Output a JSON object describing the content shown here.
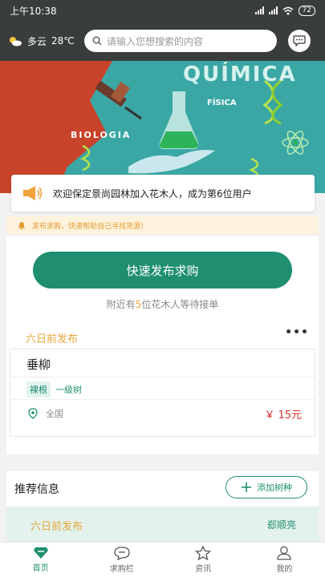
{
  "status_bar": {
    "time": "上午10:38",
    "battery": "72"
  },
  "top_bar": {
    "weather_text": "多云",
    "temperature": "28℃",
    "search_placeholder": "请输入您想搜索的内容"
  },
  "banner": {
    "word_quimica": "QUÍMICA",
    "word_biologia": "BIOLOGIA",
    "word_fisica": "FÍSICA"
  },
  "notice": {
    "text": "欢迎保定景尚园林加入花木人，成为第6位用户"
  },
  "tip": {
    "text": "发布求购，快速帮助自己寻找货源！"
  },
  "main": {
    "publish_button": "快速发布求购",
    "nearby_prefix": "附近有",
    "nearby_count": "5",
    "nearby_suffix": "位花木人等待接单",
    "time_ago": "六日前发布",
    "more": "•••",
    "item": {
      "name": "垂柳",
      "tag": "裸根",
      "grade": "一级树",
      "location": "全国",
      "price": "￥ 15元"
    }
  },
  "recommend": {
    "title": "推荐信息",
    "add_button": "添加树种",
    "time_ago": "六日前发布",
    "user": "郄顺亮"
  },
  "tabs": [
    {
      "label": "首页",
      "icon": "home-gem-icon",
      "active": true
    },
    {
      "label": "求购栏",
      "icon": "chat-bubble-icon",
      "active": false
    },
    {
      "label": "资讯",
      "icon": "star-icon",
      "active": false
    },
    {
      "label": "我的",
      "icon": "user-icon",
      "active": false
    }
  ],
  "colors": {
    "brand": "#1f8f6f",
    "accent": "#e5a63b",
    "price": "#d9302c",
    "topbar": "#3a3d3e"
  }
}
